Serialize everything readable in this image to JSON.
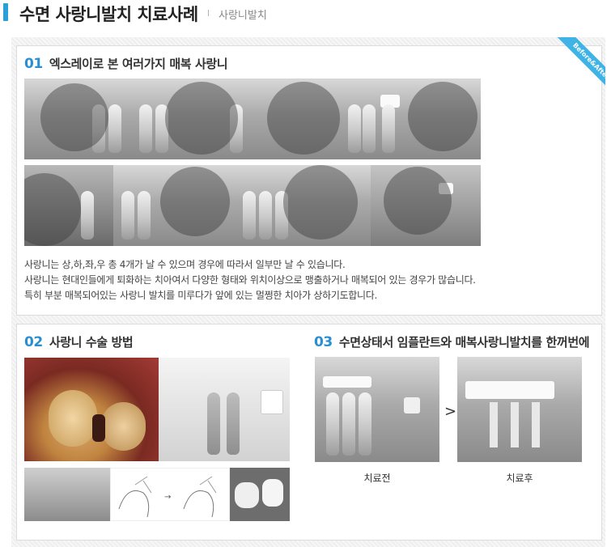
{
  "header": {
    "title": "수면 사랑니발치 치료사례",
    "separator": "l",
    "subtitle": "사랑니발치"
  },
  "ribbon": {
    "label": "Before&After"
  },
  "section1": {
    "number": "01",
    "title": "엑스레이로 본 여러가지 매복 사랑니",
    "description": [
      "사랑니는 상,하,좌,우 총 4개가 날 수 있으며 경우에 따라서 일부만 날 수 있습니다.",
      "사랑니는 현대인들에게 퇴화하는 치아여서 다양한 형태와 위치이상으로 맹출하거나 매복되어 있는 경우가 많습니다.",
      "특히 부분 매복되어있는 사랑니 발치를 미루다가 앞에 있는 멀쩡한 치아가 상하기도합니다."
    ]
  },
  "section2": {
    "number": "02",
    "title": "사랑니 수술 방법"
  },
  "section3": {
    "number": "03",
    "title": "수면상태서 임플란트와 매복사랑니발치를  한꺼번에",
    "before_label": "치료전",
    "after_label": "치료후",
    "arrow": ">"
  }
}
